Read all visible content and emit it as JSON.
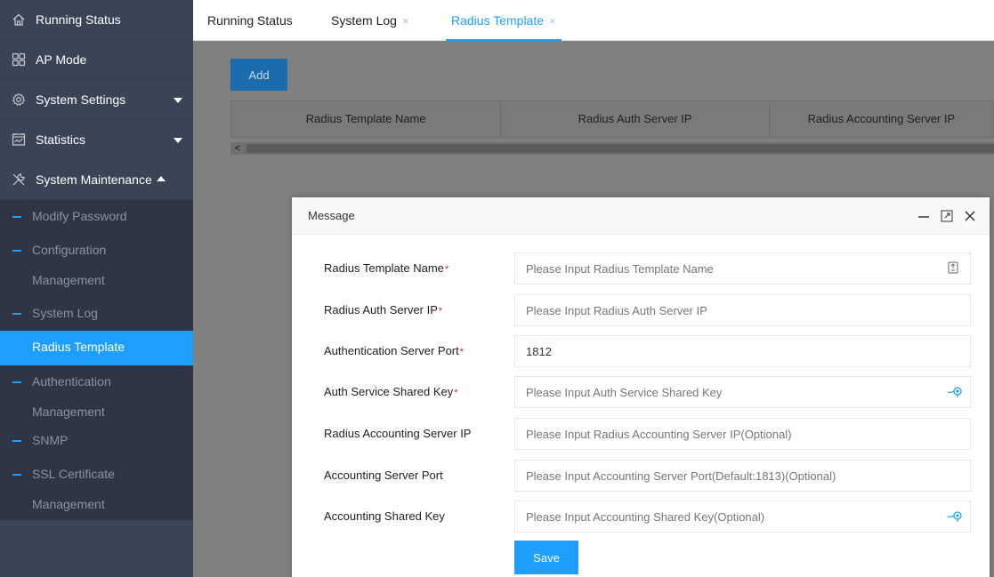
{
  "sidebar": {
    "items": [
      {
        "label": "Running Status",
        "icon": "home-icon"
      },
      {
        "label": "AP Mode",
        "icon": "grid-icon"
      },
      {
        "label": "System Settings",
        "icon": "gear-icon"
      },
      {
        "label": "Statistics",
        "icon": "chart-icon"
      },
      {
        "label": "System Maintenance",
        "icon": "tools-icon"
      }
    ],
    "submenu": [
      {
        "label_line1": "Modify Password",
        "label_line2": ""
      },
      {
        "label_line1": "Configuration",
        "label_line2": "Management"
      },
      {
        "label_line1": "System Log",
        "label_line2": ""
      },
      {
        "label_line1": "Radius Template",
        "label_line2": ""
      },
      {
        "label_line1": "Authentication",
        "label_line2": "Management"
      },
      {
        "label_line1": "SNMP",
        "label_line2": ""
      },
      {
        "label_line1": "SSL Certificate",
        "label_line2": "Management"
      }
    ],
    "active_submenu": "Radius Template",
    "colors": {
      "bg": "#3b4456",
      "sub_bg": "#2e3544",
      "accent": "#1e9fff"
    }
  },
  "tabs": [
    {
      "label": "Running Status",
      "closable": false
    },
    {
      "label": "System Log",
      "closable": true
    },
    {
      "label": "Radius Template",
      "closable": true
    }
  ],
  "tab_close_glyph": "×",
  "toolbar": {
    "add_label": "Add"
  },
  "table": {
    "columns": [
      "Radius Template Name",
      "Radius Auth Server IP",
      "Radius Accounting Server IP"
    ]
  },
  "scroll_left_glyph": "<",
  "modal": {
    "title": "Message",
    "fields": [
      {
        "label": "Radius Template Name",
        "required": true,
        "value": "",
        "placeholder": "Please Input Radius Template Name",
        "icon": "keyboard-icon"
      },
      {
        "label": "Radius Auth Server IP",
        "required": true,
        "value": "",
        "placeholder": "Please Input Radius Auth Server IP",
        "icon": ""
      },
      {
        "label": "Authentication Server Port",
        "required": true,
        "value": "1812",
        "placeholder": "",
        "icon": ""
      },
      {
        "label": "Auth Service Shared Key",
        "required": true,
        "value": "",
        "placeholder": "Please Input Auth Service Shared Key",
        "icon": "eye-icon"
      },
      {
        "label": "Radius Accounting Server IP",
        "required": false,
        "value": "",
        "placeholder": "Please Input Radius Accounting Server IP(Optional)",
        "icon": ""
      },
      {
        "label": "Accounting Server Port",
        "required": false,
        "value": "",
        "placeholder": "Please Input Accounting Server Port(Default:1813)(Optional)",
        "icon": ""
      },
      {
        "label": "Accounting Shared Key",
        "required": false,
        "value": "",
        "placeholder": "Please Input Accounting Shared Key(Optional)",
        "icon": "eye-icon"
      }
    ],
    "required_mark": "*",
    "save_label": "Save"
  }
}
